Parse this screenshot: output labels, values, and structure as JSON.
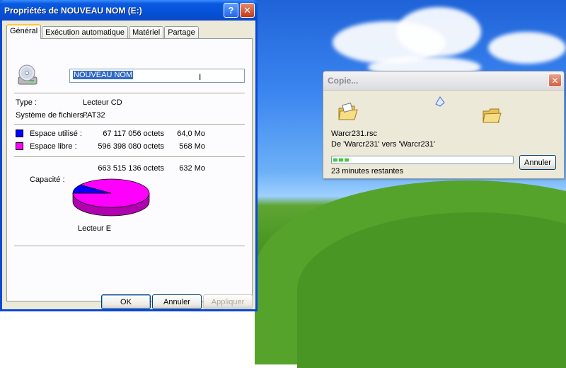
{
  "properties": {
    "title": "Propriétés de NOUVEAU NOM (E:)",
    "tabs": [
      {
        "label": "Général"
      },
      {
        "label": "Exécution automatique"
      },
      {
        "label": "Matériel"
      },
      {
        "label": "Partage"
      }
    ],
    "active_tab": "Général",
    "drive_name_value": "NOUVEAU NOM",
    "type_label": "Type :",
    "type_value": "Lecteur CD",
    "fs_label": "Système de fichiers :",
    "fs_value": "FAT32",
    "used": {
      "label": "Espace utilisé :",
      "bytes": "67 117 056 octets",
      "size": "64,0 Mo",
      "color": "#0000ff"
    },
    "free": {
      "label": "Espace libre :",
      "bytes": "596 398 080 octets",
      "size": "568 Mo",
      "color": "#ff00ff"
    },
    "capacity": {
      "label": "Capacité :",
      "bytes": "663 515 136 octets",
      "size": "632 Mo"
    },
    "drive_letter_label": "Lecteur E",
    "used_fraction": 0.101,
    "buttons": {
      "ok": "OK",
      "cancel": "Annuler",
      "apply": "Appliquer"
    }
  },
  "copy_dialog": {
    "title": "Copie...",
    "file_name": "Warcr231.rsc",
    "from_to": "De 'Warcr231' vers 'Warcr231'",
    "progress_fraction": 0.09,
    "time_remaining": "23 minutes restantes",
    "cancel_label": "Annuler"
  }
}
